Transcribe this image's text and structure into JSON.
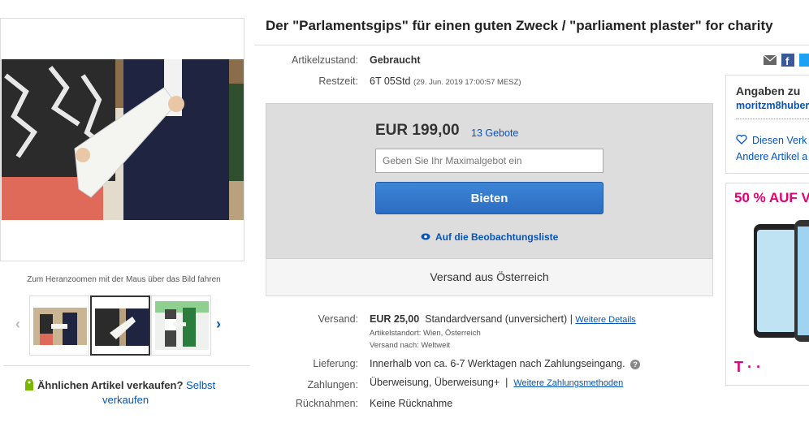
{
  "listing": {
    "title": "Der \"Parlamentsgips\" für einen guten Zweck / \"parliament plaster\" for charity",
    "condition_label": "Artikelzustand:",
    "condition_value": "Gebraucht",
    "time_label": "Restzeit:",
    "time_value": "6T 05Std",
    "time_end": "(29. Jun. 2019   17:00:57 MESZ)"
  },
  "gallery": {
    "zoom_hint": "Zum Heranzoomen mit der Maus über das Bild fahren",
    "prev_icon": "chevron-left-icon",
    "next_icon": "chevron-right-icon"
  },
  "sell_similar": {
    "text": "Ähnlichen Artikel verkaufen?",
    "link_1": "Selbst",
    "link_2": "verkaufen"
  },
  "bid": {
    "price": "EUR 199,00",
    "bid_count": "13 Gebote",
    "max_bid_placeholder": "Geben Sie Ihr Maximalgebot ein",
    "bid_button": "Bieten",
    "watchlist": "Auf die Beobachtungsliste",
    "ship_from": "Versand aus Österreich"
  },
  "shipping": {
    "label": "Versand:",
    "price": "EUR 25,00",
    "method": "Standardversand (unversichert)",
    "separator": "|",
    "details_link": "Weitere Details",
    "location": "Artikelstandort: Wien, Österreich",
    "ships_to": "Versand nach: Weltweit"
  },
  "delivery": {
    "label": "Lieferung:",
    "value": "Innerhalb von ca. 6-7 Werktagen nach Zahlungseingang."
  },
  "payment": {
    "label": "Zahlungen:",
    "value": "Überweisung,  Überweisung+",
    "separator": "|",
    "more_link": "Weitere Zahlungsmethoden"
  },
  "returns": {
    "label": "Rücknahmen:",
    "value": "Keine Rücknahme"
  },
  "seller": {
    "title": "Angaben zu",
    "name": "moritzm8huber",
    "save_seller": "Diesen Verk",
    "other_items": "Andere Artikel a"
  },
  "ad": {
    "headline": "50 % AUF V",
    "brand": "T · ·"
  },
  "colors": {
    "link": "#0654ba",
    "bid_button": "#2b6cc2",
    "brand_ad": "#e20074"
  }
}
